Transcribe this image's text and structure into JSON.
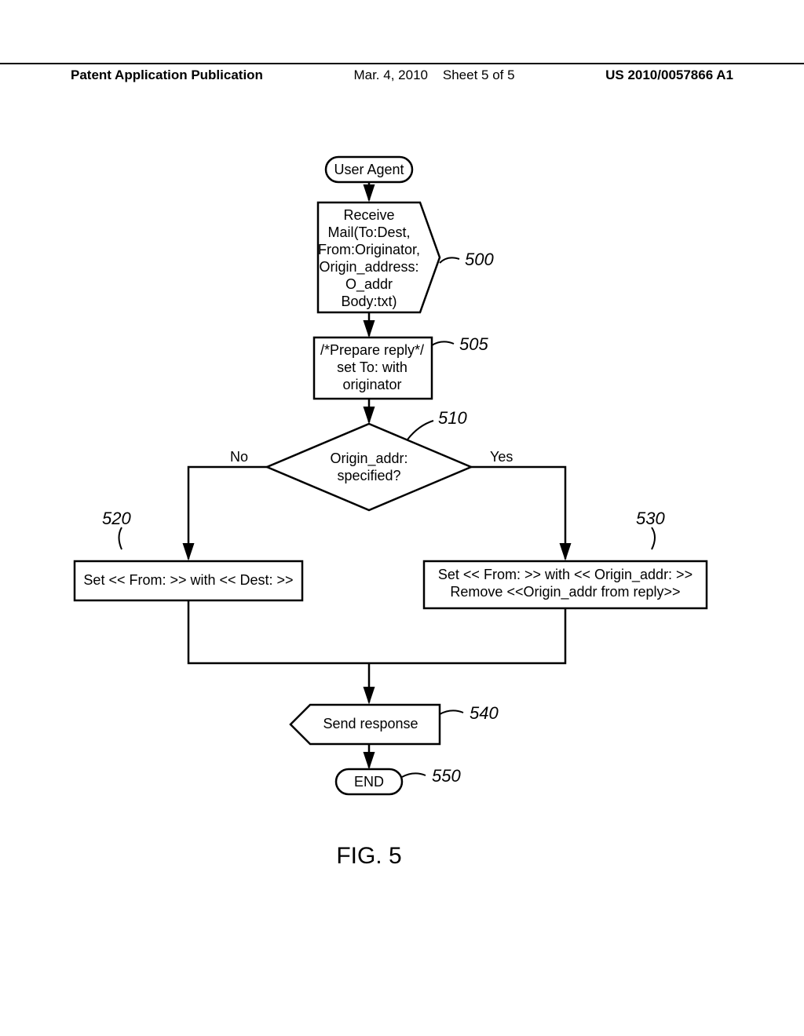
{
  "header": {
    "left": "Patent Application Publication",
    "mid_date": "Mar. 4, 2010",
    "mid_sheet": "Sheet 5 of 5",
    "right": "US 2010/0057866 A1"
  },
  "figure_label": "FIG. 5",
  "nodes": {
    "start": "User Agent",
    "receive_l1": "Receive",
    "receive_l2": "Mail(To:Dest,",
    "receive_l3": "From:Originator,",
    "receive_l4": "Origin_address:",
    "receive_l5": "O_addr",
    "receive_l6": "Body:txt)",
    "prepare_l1": "/*Prepare reply*/",
    "prepare_l2": "set To: with",
    "prepare_l3": "originator",
    "decision_l1": "Origin_addr:",
    "decision_l2": "specified?",
    "decision_no": "No",
    "decision_yes": "Yes",
    "left_box": "Set << From: >> with << Dest: >>",
    "right_box_l1": "Set << From: >> with << Origin_addr: >>",
    "right_box_l2": "Remove <<Origin_addr from reply>>",
    "send": "Send response",
    "end": "END"
  },
  "refs": {
    "r500": "500",
    "r505": "505",
    "r510": "510",
    "r520": "520",
    "r530": "530",
    "r540": "540",
    "r550": "550"
  }
}
